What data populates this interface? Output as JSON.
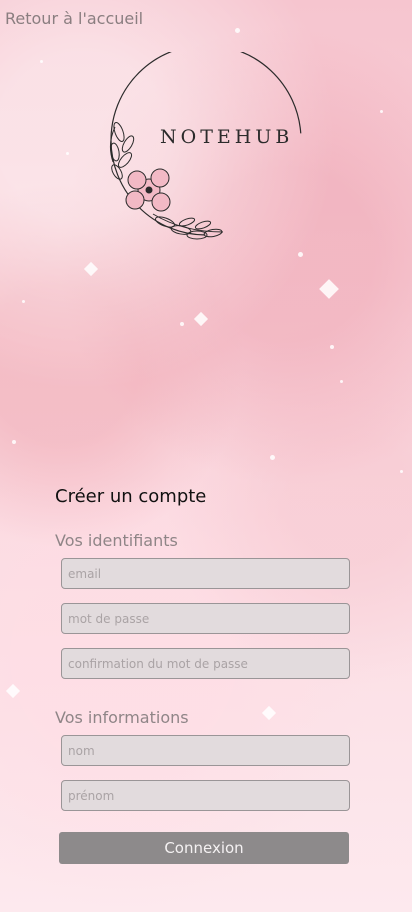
{
  "nav": {
    "home_label": "Retour à l'accueil"
  },
  "brand": {
    "name": "NOTEHUB"
  },
  "form": {
    "title": "Créer un compte",
    "credentials_title": "Vos identifiants",
    "email_placeholder": "email",
    "password_placeholder": "mot de passe",
    "confirm_placeholder": "confirmation du mot de passe",
    "info_title": "Vos informations",
    "name_placeholder": "nom",
    "firstname_placeholder": "prénom",
    "submit_label": "Connexion"
  },
  "colors": {
    "background": "#f9d0d8",
    "field_bg": "#e2dbdd",
    "button_bg": "#8d8a8b"
  }
}
